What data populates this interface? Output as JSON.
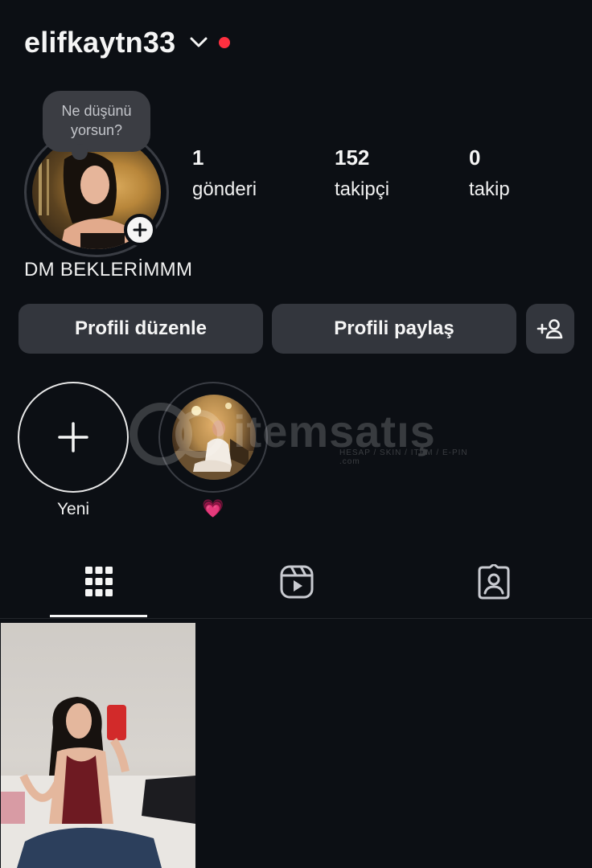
{
  "profile": {
    "username": "elifkaytn33",
    "note_bubble": "Ne düşünü\nyorsun?",
    "bio": "DM BEKLERİMMM"
  },
  "stats": [
    {
      "value": "1",
      "label": "gönderi"
    },
    {
      "value": "152",
      "label": "takipçi"
    },
    {
      "value": "0",
      "label": "takip"
    }
  ],
  "buttons": {
    "edit_profile": "Profili düzenle",
    "share_profile": "Profili paylaş",
    "discover_people_icon": "add-person-icon"
  },
  "highlights": [
    {
      "label": "Yeni",
      "icon": "plus-icon"
    },
    {
      "label": "💗"
    }
  ],
  "watermark": {
    "text": "itemsatış",
    "subtext": "HESAP / SKIN / ITEM / E-PIN  .com"
  },
  "tabs": [
    {
      "icon": "grid-icon",
      "active": true
    },
    {
      "icon": "reels-icon",
      "active": false
    },
    {
      "icon": "tagged-icon",
      "active": false
    }
  ],
  "colors": {
    "background": "#0c0f14",
    "button": "#33363d",
    "notification_dot": "#ff3040"
  }
}
